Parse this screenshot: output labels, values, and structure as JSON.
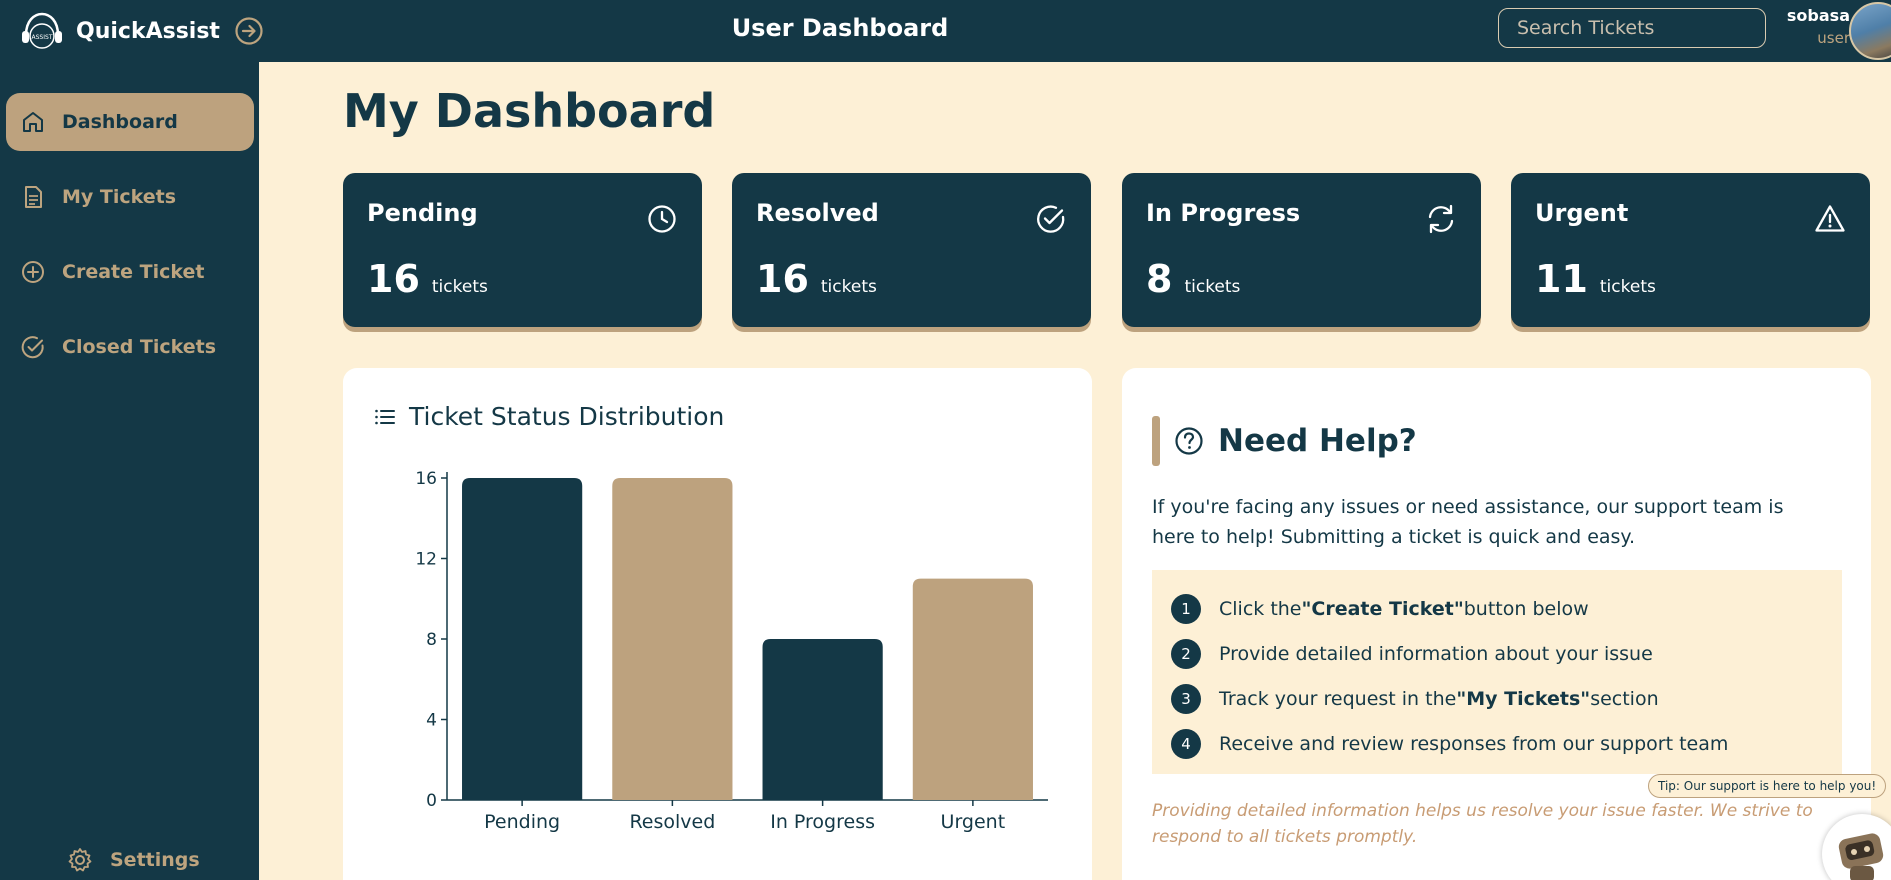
{
  "app": {
    "name": "QuickAssist",
    "logo_text": "ASSIST"
  },
  "header": {
    "title": "User Dashboard",
    "search_placeholder": "Search Tickets"
  },
  "user": {
    "name": "sobasa",
    "role": "user"
  },
  "sidebar": {
    "items": [
      {
        "label": "Dashboard",
        "icon": "home-icon",
        "active": true
      },
      {
        "label": "My Tickets",
        "icon": "document-icon",
        "active": false
      },
      {
        "label": "Create Ticket",
        "icon": "plus-circle-icon",
        "active": false
      },
      {
        "label": "Closed Tickets",
        "icon": "check-circle-icon",
        "active": false
      }
    ],
    "settings_label": "Settings"
  },
  "main": {
    "title": "My Dashboard",
    "stats": [
      {
        "title": "Pending",
        "value": "16",
        "unit": "tickets",
        "icon": "clock-icon"
      },
      {
        "title": "Resolved",
        "value": "16",
        "unit": "tickets",
        "icon": "check-circle-icon"
      },
      {
        "title": "In Progress",
        "value": "8",
        "unit": "tickets",
        "icon": "refresh-icon"
      },
      {
        "title": "Urgent",
        "value": "11",
        "unit": "tickets",
        "icon": "warning-icon"
      }
    ]
  },
  "chart_panel": {
    "title": "Ticket Status Distribution"
  },
  "chart_data": {
    "type": "bar",
    "categories": [
      "Pending",
      "Resolved",
      "In Progress",
      "Urgent"
    ],
    "values": [
      16,
      16,
      8,
      11
    ],
    "colors": [
      "#143846",
      "#bda27e",
      "#143846",
      "#bda27e"
    ],
    "yticks": [
      0,
      4,
      8,
      12,
      16
    ],
    "ylim": [
      0,
      16
    ],
    "grid": false,
    "title": "",
    "xlabel": "",
    "ylabel": ""
  },
  "help": {
    "title": "Need Help?",
    "intro": "If you're facing any issues or need assistance, our support team is here to help! Submitting a ticket is quick and easy.",
    "steps": [
      {
        "num": "1",
        "before": "Click the",
        "strong": "\"Create Ticket\"",
        "after": "button below"
      },
      {
        "num": "2",
        "before": "Provide detailed information about your issue",
        "strong": "",
        "after": ""
      },
      {
        "num": "3",
        "before": "Track your request in the",
        "strong": "\"My Tickets\"",
        "after": "section"
      },
      {
        "num": "4",
        "before": "Receive and review responses from our support team",
        "strong": "",
        "after": ""
      }
    ],
    "note": "Providing detailed information helps us resolve your issue faster. We strive to respond to all tickets promptly."
  },
  "assistant": {
    "tip": "Tip: Our support is here to help you!"
  },
  "colors": {
    "primary": "#143846",
    "accent": "#bda27e",
    "background": "#fdf0d6",
    "panel": "#ffffff"
  }
}
